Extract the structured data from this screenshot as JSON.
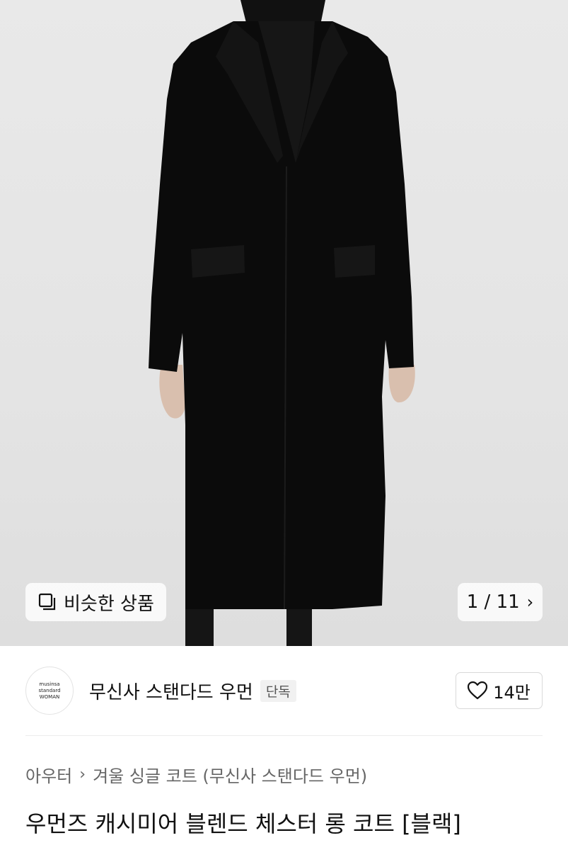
{
  "gallery": {
    "similar_label": "비슷한 상품",
    "counter": "1 / 11",
    "counter_chevron": "›"
  },
  "brand": {
    "logo_lines": [
      "musinsa",
      "standard",
      "WOMAN"
    ],
    "name": "무신사 스탠다드 우먼",
    "tag": "단독",
    "likes": "14만"
  },
  "breadcrumb": {
    "items": [
      "아우터",
      "겨울 싱글 코트 (무신사 스탠다드 우먼)"
    ],
    "separator": "›"
  },
  "product": {
    "title": "우먼즈 캐시미어 블렌드 체스터 롱 코트 [블랙]"
  },
  "colors": {
    "background": "#e6e6e6",
    "coat": "#0b0b0b",
    "skin": "#d9bfae"
  },
  "icons": {
    "similar": "stacked-squares-icon",
    "like": "heart-outline-icon",
    "next": "chevron-right-icon"
  }
}
